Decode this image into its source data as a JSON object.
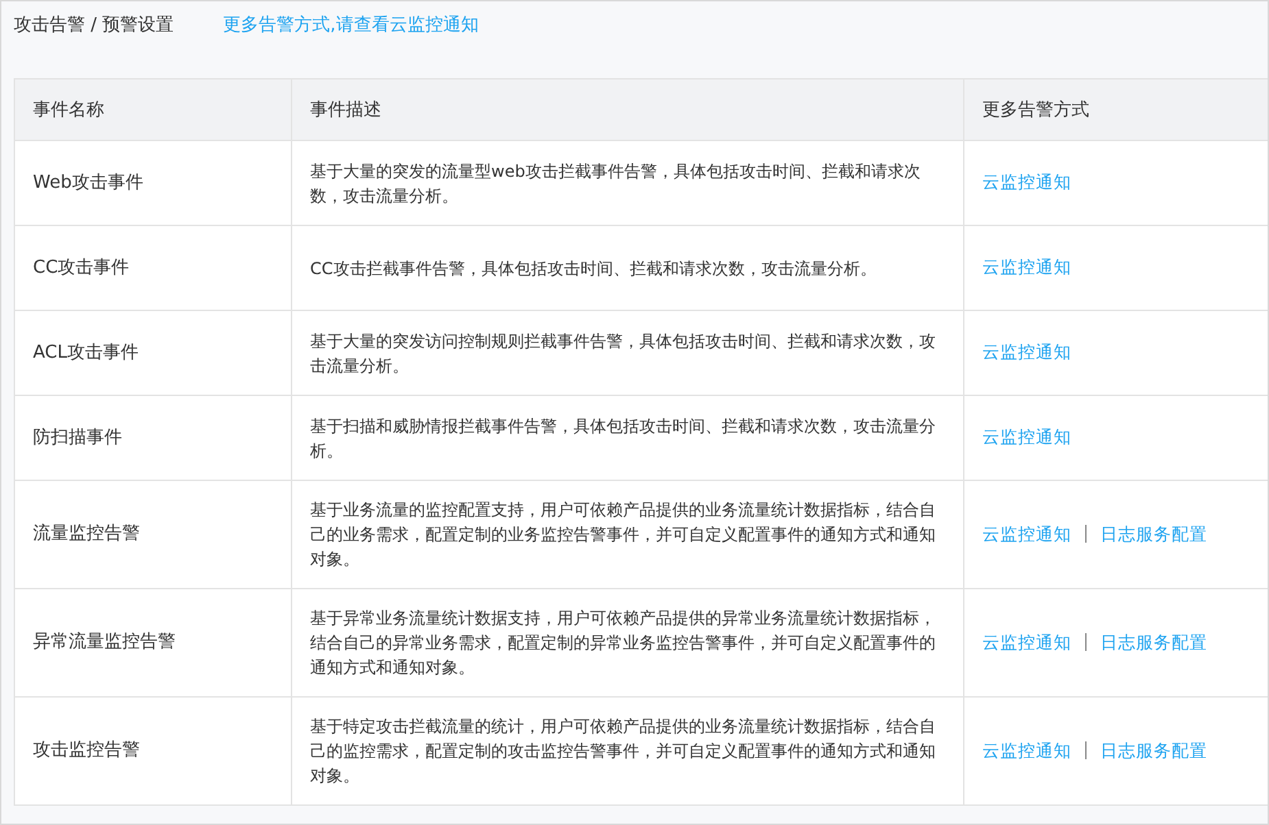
{
  "breadcrumb": "攻击告警 / 预警设置",
  "top_link": "更多告警方式,请查看云监控通知",
  "table": {
    "columns": [
      "事件名称",
      "事件描述",
      "更多告警方式"
    ],
    "rows": [
      {
        "name": "Web攻击事件",
        "description": "基于大量的突发的流量型web攻击拦截事件告警，具体包括攻击时间、拦截和请求次数，攻击流量分析。",
        "links": [
          "云监控通知"
        ]
      },
      {
        "name": "CC攻击事件",
        "description": "CC攻击拦截事件告警，具体包括攻击时间、拦截和请求次数，攻击流量分析。",
        "links": [
          "云监控通知"
        ]
      },
      {
        "name": "ACL攻击事件",
        "description": "基于大量的突发访问控制规则拦截事件告警，具体包括攻击时间、拦截和请求次数，攻击流量分析。",
        "links": [
          "云监控通知"
        ]
      },
      {
        "name": "防扫描事件",
        "description": "基于扫描和威胁情报拦截事件告警，具体包括攻击时间、拦截和请求次数，攻击流量分析。",
        "links": [
          "云监控通知"
        ]
      },
      {
        "name": "流量监控告警",
        "description": "基于业务流量的监控配置支持，用户可依赖产品提供的业务流量统计数据指标，结合自己的业务需求，配置定制的业务监控告警事件，并可自定义配置事件的通知方式和通知对象。",
        "links": [
          "云监控通知",
          "日志服务配置"
        ]
      },
      {
        "name": "异常流量监控告警",
        "description": "基于异常业务流量统计数据支持，用户可依赖产品提供的异常业务流量统计数据指标，结合自己的异常业务需求，配置定制的异常业务监控告警事件，并可自定义配置事件的通知方式和通知对象。",
        "links": [
          "云监控通知",
          "日志服务配置"
        ]
      },
      {
        "name": "攻击监控告警",
        "description": "基于特定攻击拦截流量的统计，用户可依赖产品提供的业务流量统计数据指标，结合自己的监控需求，配置定制的攻击监控告警事件，并可自定义配置事件的通知方式和通知对象。",
        "links": [
          "云监控通知",
          "日志服务配置"
        ]
      }
    ]
  }
}
